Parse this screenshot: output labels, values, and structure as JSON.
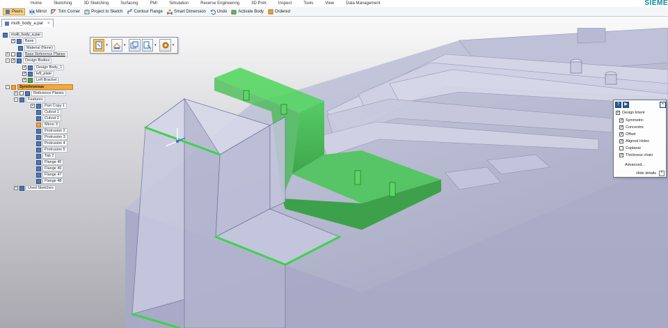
{
  "menu": {
    "items": [
      "Home",
      "Sketching",
      "3D Sketching",
      "Surfacing",
      "PMI",
      "Simulation",
      "Reverse Engineering",
      "3D Print",
      "Inspect",
      "Tools",
      "View",
      "Data Management"
    ],
    "brand": "SIEME"
  },
  "toolbar": {
    "items": [
      {
        "label": "Peers",
        "icon": "peers-icon"
      },
      {
        "label": "Mirror",
        "icon": "mirror-icon"
      },
      {
        "label": "Trim Corner",
        "icon": "trim-corner-icon"
      },
      {
        "label": "Project to Sketch",
        "icon": "project-sketch-icon"
      },
      {
        "label": "Contour Flange",
        "icon": "contour-flange-icon"
      },
      {
        "label": "Smart Dimension",
        "icon": "smart-dimension-icon"
      },
      {
        "label": "Undo",
        "icon": "undo-icon"
      },
      {
        "label": "Activate Body",
        "icon": "activate-body-icon"
      },
      {
        "label": "Ordered",
        "icon": "ordered-icon"
      }
    ]
  },
  "document": {
    "tab_label": "multi_body_a.par",
    "close_glyph": "×"
  },
  "tree": {
    "root": "multi_body_a.par",
    "base": "Base",
    "material": "Material (None)",
    "base_planes": "Base Reference Planes",
    "design_bodies": "Design Bodies",
    "bodies": [
      "Design Body_1",
      "left_plate",
      "Left Bracket"
    ],
    "synchronous": "Synchronous",
    "ref_planes": "Reference Planes",
    "features": "Features",
    "feature_items": [
      "Part Copy 1",
      "Cutout 1",
      "Cutout 2",
      "Mirror 3",
      "Protrusion 2",
      "Protrusion 3",
      "Protrusion 4",
      "Protrusion 5",
      "Tab 2",
      "Flange 45",
      "Flange 46",
      "Flange 47",
      "Flange 48"
    ],
    "used_sketches": "Used Sketches"
  },
  "design_intent": {
    "title": "Design Intent",
    "help_glyph": "?",
    "play_glyph": "▶",
    "options": [
      {
        "label": "Symmetric",
        "checked": true
      },
      {
        "label": "Concentric",
        "checked": true
      },
      {
        "label": "Offset",
        "checked": true
      },
      {
        "label": "Aligned Holes",
        "checked": true
      },
      {
        "label": "Coplanar",
        "checked": false
      },
      {
        "label": "Thickness chain",
        "checked": true
      }
    ],
    "advanced": "Advanced...",
    "hide_details": "Hide details"
  },
  "colors": {
    "selection_green": "#3dc24a",
    "body_fill": "#b4b8d2",
    "accent_orange": "#f2a93a"
  }
}
